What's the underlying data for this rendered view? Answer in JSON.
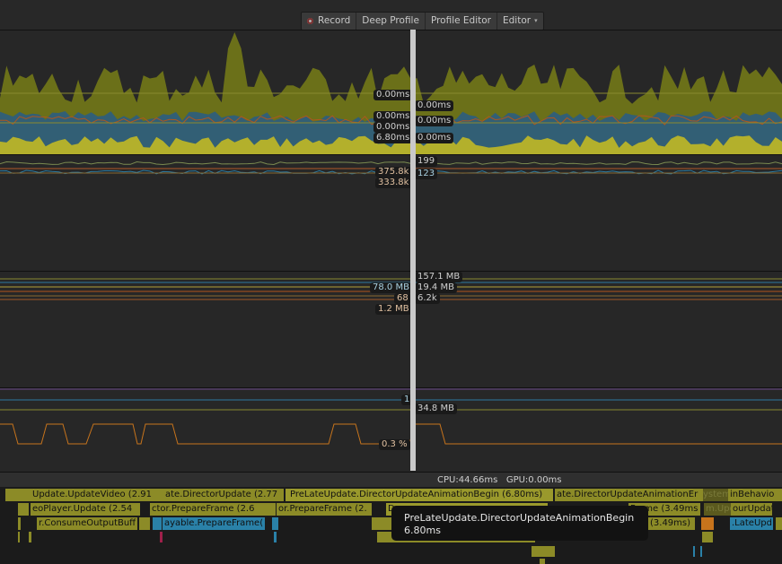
{
  "toolbar": {
    "record_label": "Record",
    "deep_profile_label": "Deep Profile",
    "profile_editor_label": "Profile Editor",
    "editor_label": "Editor",
    "editor_caret": "▾"
  },
  "panes": {
    "cpu": {
      "labels_left": [
        "0.00ms",
        "0.00ms",
        "0.00ms",
        "6.80ms"
      ],
      "labels_right": [
        "0.00ms",
        "0.00ms",
        "0.00ms"
      ]
    },
    "rendering": {
      "labels_left": [
        "375.8k",
        "333.8k"
      ],
      "labels_right": [
        "199",
        "123"
      ]
    },
    "memory": {
      "labels_left": [
        "78.0 MB",
        "68",
        "1.2 MB"
      ],
      "labels_right": [
        "157.1 MB",
        "19.4 MB",
        "6.2k"
      ]
    },
    "misc": {
      "labels_left": [
        "1",
        "0.3 %"
      ],
      "labels_right": [
        "34.8 MB"
      ]
    }
  },
  "status": {
    "cpu_text": "CPU:44.66ms",
    "gpu_text": "GPU:0.00ms"
  },
  "timeline": {
    "row1": [
      "Update.UpdateVideo (2.91",
      "ate.DirectorUpdate (2.77",
      "PreLateUpdate.DirectorUpdateAnimationBegin (6.80ms)",
      "ate.DirectorUpdateAnimationEr",
      "ystem",
      "inBehavio"
    ],
    "row2": [
      "eoPlayer.Update (2.54",
      "ctor.PrepareFrame (2.6",
      "or.PrepareFrame (2.",
      "D",
      "Frame (3.49ms",
      "m.Upd",
      "ourUpdat"
    ],
    "row3": [
      "r.ConsumeOutputBuff",
      "ayable.PrepareFrame(",
      "(3.49ms)",
      ".LateUpd"
    ]
  },
  "tooltip": {
    "title": "PreLateUpdate.DirectorUpdateAnimationBegin",
    "value": "6.80ms"
  },
  "colors": {
    "cpu_olive": "#6b7019",
    "cpu_yellow": "#b3b02c",
    "cpu_blue": "#2c5d80",
    "cpu_orange": "#b0561e",
    "cursor": "#c9c9c9"
  }
}
